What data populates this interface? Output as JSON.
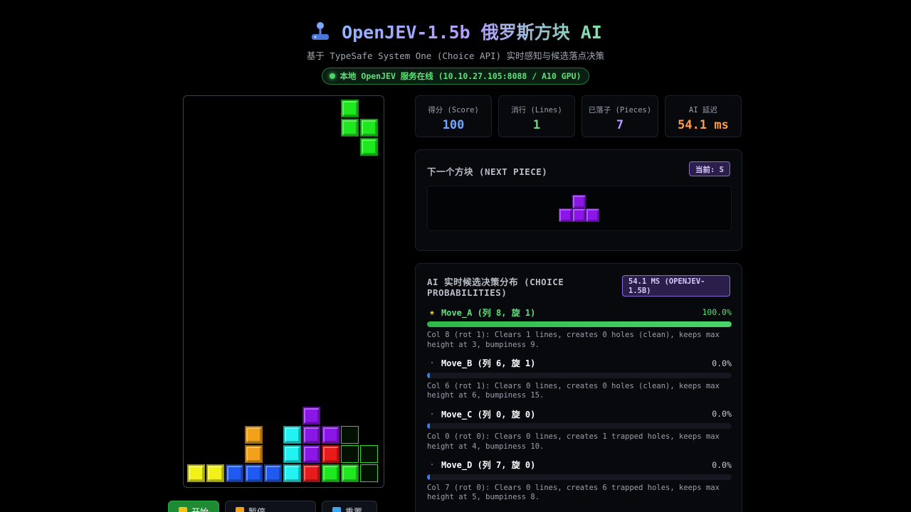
{
  "header": {
    "title": "OpenJEV-1.5b 俄罗斯方块 AI",
    "subtitle": "基于 TypeSafe System One (Choice API) 实时感知与候选落点决策",
    "status": "本地 OpenJEV 服务在线 (10.10.27.105:8088 / A10 GPU)",
    "icon": "joystick-icon"
  },
  "stats": [
    {
      "label": "得分 (Score)",
      "value": "100",
      "color": "#6ea8ff"
    },
    {
      "label": "消行 (Lines)",
      "value": "1",
      "color": "#5ee07a"
    },
    {
      "label": "已落子 (Pieces)",
      "value": "7",
      "color": "#b69cff"
    },
    {
      "label": "AI 延迟",
      "value": "54.1 ms",
      "color": "#ff9b4a"
    }
  ],
  "next_piece": {
    "title": "下一个方块 (NEXT PIECE)",
    "current_badge": "当前: S",
    "shape": "T",
    "color": "#8a16e8"
  },
  "ai": {
    "title": "AI 实时候选决策分布 (CHOICE PROBABILITIES)",
    "latency_badge": "54.1 MS (OPENJEV-1.5B)",
    "moves": [
      {
        "name": "Move_A (列 8, 旋 1)",
        "pct": "100.0%",
        "value": 1.0,
        "best": true,
        "desc": "Col 8 (rot 1): Clears 1 lines, creates 0 holes (clean), keeps max height at 3, bumpiness 9."
      },
      {
        "name": "Move_B (列 6, 旋 1)",
        "pct": "0.0%",
        "value": 0.0,
        "best": false,
        "desc": "Col 6 (rot 1): Clears 0 lines, creates 0 holes (clean), keeps max height at 6, bumpiness 15."
      },
      {
        "name": "Move_C (列 0, 旋 0)",
        "pct": "0.0%",
        "value": 0.0,
        "best": false,
        "desc": "Col 0 (rot 0): Clears 0 lines, creates 1 trapped holes, keeps max height at 4, bumpiness 10."
      },
      {
        "name": "Move_D (列 7, 旋 0)",
        "pct": "0.0%",
        "value": 0.0,
        "best": false,
        "desc": "Col 7 (rot 0): Clears 0 lines, creates 6 trapped holes, keeps max height at 5, bumpiness 8."
      }
    ]
  },
  "colors": {
    "I": "#22f2f2",
    "O": "#f2f21a",
    "T": "#8a16e8",
    "S": "#1ee81e",
    "Z": "#e81a1a",
    "J": "#1e5af2",
    "L": "#f2a21a"
  },
  "board": {
    "cols": 10,
    "rows": 20,
    "falling": [
      {
        "c": 8,
        "r": 0,
        "k": "S"
      },
      {
        "c": 8,
        "r": 1,
        "k": "S"
      },
      {
        "c": 9,
        "r": 1,
        "k": "S"
      },
      {
        "c": 9,
        "r": 2,
        "k": "S"
      }
    ],
    "ghost": [
      {
        "c": 8,
        "r": 17
      },
      {
        "c": 8,
        "r": 18
      },
      {
        "c": 9,
        "r": 18
      },
      {
        "c": 9,
        "r": 19
      }
    ],
    "stack": [
      {
        "c": 6,
        "r": 16,
        "k": "T"
      },
      {
        "c": 3,
        "r": 17,
        "k": "L"
      },
      {
        "c": 5,
        "r": 17,
        "k": "I"
      },
      {
        "c": 6,
        "r": 17,
        "k": "T"
      },
      {
        "c": 7,
        "r": 17,
        "k": "T"
      },
      {
        "c": 3,
        "r": 18,
        "k": "L"
      },
      {
        "c": 5,
        "r": 18,
        "k": "I"
      },
      {
        "c": 6,
        "r": 18,
        "k": "T"
      },
      {
        "c": 7,
        "r": 18,
        "k": "Z"
      },
      {
        "c": 0,
        "r": 19,
        "k": "O"
      },
      {
        "c": 1,
        "r": 19,
        "k": "O"
      },
      {
        "c": 2,
        "r": 19,
        "k": "J"
      },
      {
        "c": 3,
        "r": 19,
        "k": "J"
      },
      {
        "c": 4,
        "r": 19,
        "k": "J"
      },
      {
        "c": 5,
        "r": 19,
        "k": "I"
      },
      {
        "c": 6,
        "r": 19,
        "k": "Z"
      },
      {
        "c": 7,
        "r": 19,
        "k": "S"
      },
      {
        "c": 8,
        "r": 19,
        "k": "S"
      }
    ]
  },
  "buttons": [
    {
      "label": "开始",
      "color": "#f2c21a",
      "primary": true
    },
    {
      "label": "暂停",
      "color": "#f2a21a",
      "primary": false
    },
    {
      "label": "重置",
      "color": "#3aa8f0",
      "primary": false
    }
  ]
}
